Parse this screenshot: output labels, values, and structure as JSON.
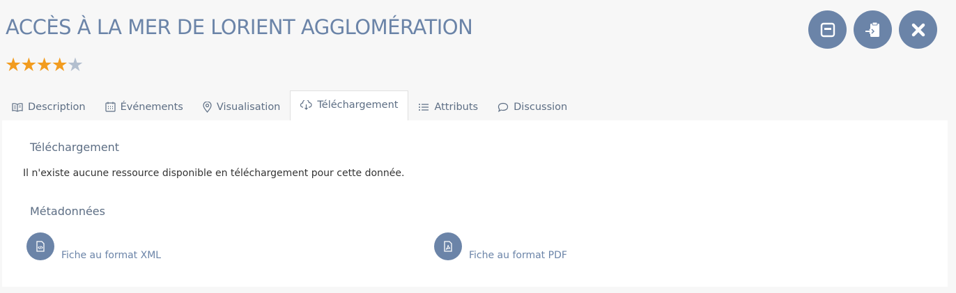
{
  "header": {
    "title": "ACCÈS À LA MER DE LORIENT AGGLOMÉRATION",
    "rating": 4,
    "rating_max": 5
  },
  "actions": [
    {
      "name": "save-icon"
    },
    {
      "name": "clipboard-import-icon"
    },
    {
      "name": "close-icon"
    }
  ],
  "tabs": [
    {
      "label": "Description",
      "icon": "book-icon"
    },
    {
      "label": "Événements",
      "icon": "calendar-icon"
    },
    {
      "label": "Visualisation",
      "icon": "map-pin-icon"
    },
    {
      "label": "Téléchargement",
      "icon": "cloud-download-icon",
      "active": true
    },
    {
      "label": "Attributs",
      "icon": "list-icon"
    },
    {
      "label": "Discussion",
      "icon": "chat-bubble-icon"
    }
  ],
  "download": {
    "title": "Téléchargement",
    "message": "Il n'existe aucune ressource disponible en téléchargement pour cette donnée."
  },
  "metadata": {
    "title": "Métadonnées",
    "files": [
      {
        "label": "Fiche au format XML",
        "icon": "xml-file-icon"
      },
      {
        "label": "Fiche au format PDF",
        "icon": "pdf-file-icon"
      }
    ]
  },
  "colors": {
    "accent": "#6b84a8",
    "star_on": "#f29c1f",
    "star_off": "#b3bfcf"
  }
}
